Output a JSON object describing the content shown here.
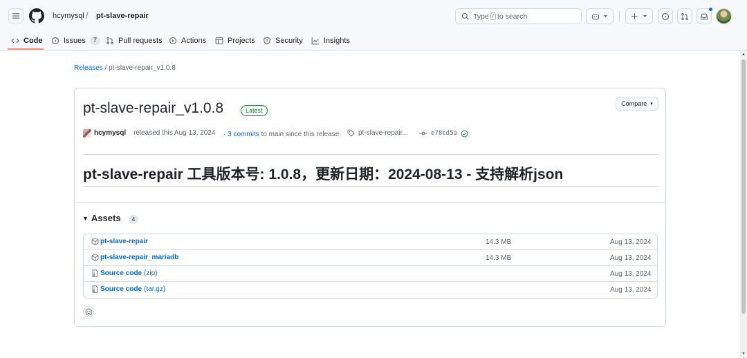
{
  "header": {
    "owner": "hcymysql",
    "separator": "/",
    "repo": "pt-slave-repair",
    "search": {
      "prefix": "Type",
      "key": "/",
      "suffix": "to search"
    }
  },
  "nav": {
    "tabs": [
      {
        "label": "Code",
        "icon": "code-icon",
        "active": true
      },
      {
        "label": "Issues",
        "icon": "issue-icon",
        "count": "7"
      },
      {
        "label": "Pull requests",
        "icon": "pull-request-icon"
      },
      {
        "label": "Actions",
        "icon": "play-icon"
      },
      {
        "label": "Projects",
        "icon": "table-icon"
      },
      {
        "label": "Security",
        "icon": "shield-icon"
      },
      {
        "label": "Insights",
        "icon": "graph-icon"
      }
    ]
  },
  "breadcrumb": {
    "root": "Releases",
    "separator": " / ",
    "current": "pt-slave-repair_v1.0.8"
  },
  "release": {
    "title": "pt-slave-repair_v1.0.8",
    "badge": "Latest",
    "compare_label": "Compare",
    "author": "hcymysql",
    "released_text": "released this Aug 13, 2024",
    "commits_prefix": "· ",
    "commits_link": "3 commits",
    "commits_suffix": " to main since this release",
    "tag": "pt-slave-repair...",
    "sha": "e78cd5a",
    "heading": "pt-slave-repair 工具版本号: 1.0.8，更新日期：2024-08-13 - 支持解析json"
  },
  "assets": {
    "label": "Assets",
    "count": "4",
    "rows": [
      {
        "name": "pt-slave-repair",
        "extra": "",
        "size": "14.3 MB",
        "date": "Aug 13, 2024",
        "icon": "package-icon"
      },
      {
        "name": "pt-slave-repair_mariadb",
        "extra": "",
        "size": "14.3 MB",
        "date": "Aug 13, 2024",
        "icon": "package-icon"
      },
      {
        "name": "Source code",
        "extra": "(zip)",
        "size": "",
        "date": "Aug 13, 2024",
        "icon": "file-zip-icon"
      },
      {
        "name": "Source code",
        "extra": "(tar.gz)",
        "size": "",
        "date": "Aug 13, 2024",
        "icon": "file-zip-icon"
      }
    ]
  },
  "colors": {
    "accent": "#0969da",
    "success": "#1a7f37",
    "tab_underline": "#fd8c73",
    "border": "#d1d9e0",
    "muted": "#59636e"
  }
}
